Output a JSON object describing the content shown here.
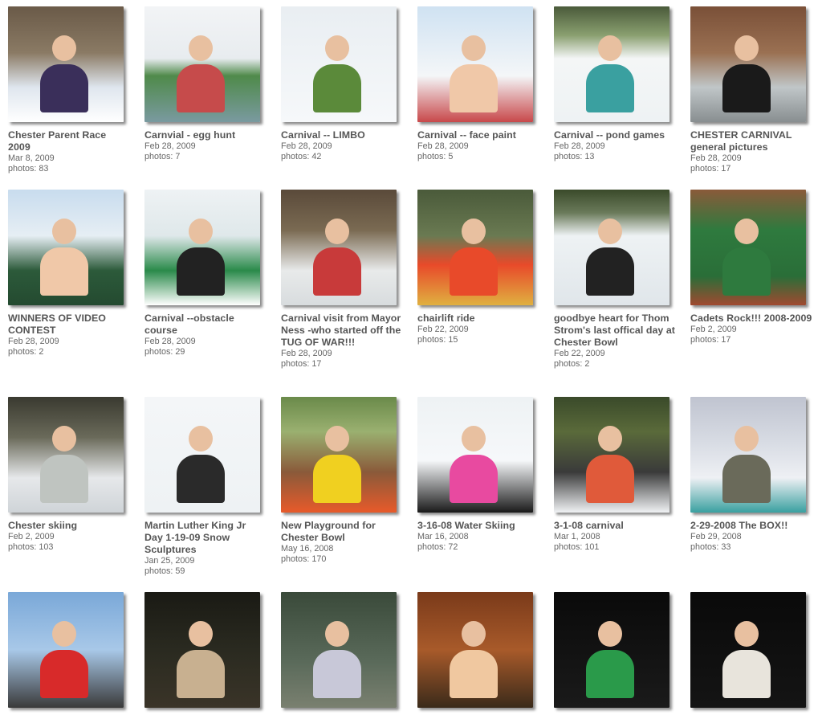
{
  "albums": [
    {
      "title": "Chester Parent Race 2009",
      "date": "Mar 8, 2009",
      "photos": "photos: 83",
      "bg": "linear-gradient(180deg,#6a5a48 0%,#8a7a64 40%,#dfe6ee 70%,#ffffff 100%)",
      "fig": "#3a2f5a"
    },
    {
      "title": "Carnvial - egg hunt",
      "date": "Feb 28, 2009",
      "photos": "photos: 7",
      "bg": "linear-gradient(180deg,#f2f4f6 0%,#e8ecef 45%,#4f8a4a 60%,#7a9aa0 100%)",
      "fig": "#c64b4b"
    },
    {
      "title": "Carnival -- LIMBO",
      "date": "Feb 28, 2009",
      "photos": "photos: 42",
      "bg": "linear-gradient(180deg,#e9eef2 0%,#f6f8fa 100%)",
      "fig": "#5b8a3a"
    },
    {
      "title": "Carnival -- face paint",
      "date": "Feb 28, 2009",
      "photos": "photos: 5",
      "bg": "linear-gradient(180deg,#cfe2f2 0%,#f4f6f8 60%,#c8484a 100%)",
      "fig": "#f0c8a8"
    },
    {
      "title": "Carnival -- pond games",
      "date": "Feb 28, 2009",
      "photos": "photos: 13",
      "bg": "linear-gradient(180deg,#4a5a3a 0%,#8aa070 25%,#f4f6f6 45%,#eef2f4 100%)",
      "fig": "#3aa0a0"
    },
    {
      "title": "CHESTER CARNIVAL general pictures",
      "date": "Feb 28, 2009",
      "photos": "photos: 17",
      "bg": "linear-gradient(180deg,#7a5038 0%,#9a7052 40%,#c0c6c8 70%,#888e90 100%)",
      "fig": "#1a1a1a"
    },
    {
      "title": "WINNERS OF VIDEO CONTEST",
      "date": "Feb 28, 2009",
      "photos": "photos: 2",
      "bg": "linear-gradient(180deg,#c8dcee 0%,#e6eef4 40%,#2c5a3a 70%,#244a30 100%)",
      "fig": "#f0c8a8"
    },
    {
      "title": "Carnival --obstacle course",
      "date": "Feb 28, 2009",
      "photos": "photos: 29",
      "bg": "linear-gradient(180deg,#eef2f4 0%,#dfe8ea 40%,#2a8a4a 70%,#ffffff 100%)",
      "fig": "#222222"
    },
    {
      "title": "Carnival visit from Mayor Ness -who started off the TUG OF WAR!!!",
      "date": "Feb 28, 2009",
      "photos": "photos: 17",
      "bg": "linear-gradient(180deg,#5a4a3a 0%,#7a6a52 35%,#e8eaea 70%,#d8dcde 100%)",
      "fig": "#c83a3a"
    },
    {
      "title": "chairlift ride",
      "date": "Feb 22, 2009",
      "photos": "photos: 15",
      "bg": "linear-gradient(180deg,#4a5a3a 0%,#6a7a52 40%,#e84a2a 65%,#e0b040 100%)",
      "fig": "#e84a2a"
    },
    {
      "title": "goodbye heart for Thom Strom's last offical day at Chester Bowl",
      "date": "Feb 22, 2009",
      "photos": "photos: 2",
      "bg": "linear-gradient(180deg,#3a4a2a 0%,#6a7a5a 20%,#eef2f4 40%,#e0e6ea 100%)",
      "fig": "#222222"
    },
    {
      "title": "Cadets Rock!!! 2008-2009",
      "date": "Feb 2, 2009",
      "photos": "photos: 17",
      "bg": "linear-gradient(180deg,#8a5a3a 0%,#2e7a3e 35%,#2a6e38 75%,#a04a30 100%)",
      "fig": "#2e7a3e"
    },
    {
      "title": "Chester skiing",
      "date": "Feb 2, 2009",
      "photos": "photos: 103",
      "bg": "linear-gradient(180deg,#3a3a30 0%,#6a6a5a 35%,#e6e8ea 70%,#cfd4d8 100%)",
      "fig": "#bfc4c0"
    },
    {
      "title": "Martin Luther King Jr Day 1-19-09 Snow Sculptures",
      "date": "Jan 25, 2009",
      "photos": "photos: 59",
      "bg": "linear-gradient(180deg,#f4f6f8 0%,#eef2f4 100%)",
      "fig": "#2a2a2a"
    },
    {
      "title": "New Playground for Chester Bowl",
      "date": "May 16, 2008",
      "photos": "photos: 170",
      "bg": "linear-gradient(180deg,#6a8a4a 0%,#9ab070 30%,#8a5a3a 65%,#e85a2a 100%)",
      "fig": "#f0d020"
    },
    {
      "title": "3-16-08 Water Skiing",
      "date": "Mar 16, 2008",
      "photos": "photos: 72",
      "bg": "linear-gradient(180deg,#eef2f4 0%,#f6f8fa 55%,#1a1a1a 100%)",
      "fig": "#e84aa0"
    },
    {
      "title": "3-1-08 carnival",
      "date": "Mar 1, 2008",
      "photos": "photos: 101",
      "bg": "linear-gradient(180deg,#3a4a2a 0%,#5a6a3a 30%,#3a3a3a 65%,#f0f2f4 100%)",
      "fig": "#e05a3a"
    },
    {
      "title": "2-29-2008 The BOX!!",
      "date": "Feb 29, 2008",
      "photos": "photos: 33",
      "bg": "linear-gradient(180deg,#c0c4d0 0%,#d8dce4 40%,#eef0f4 70%,#3aa0a0 100%)",
      "fig": "#6a6a5a"
    },
    {
      "title": "",
      "date": "",
      "photos": "",
      "bg": "linear-gradient(180deg,#7aa8d8 0%,#a8c8e8 50%,#3a3a3a 100%)",
      "fig": "#d82a2a"
    },
    {
      "title": "",
      "date": "",
      "photos": "",
      "bg": "linear-gradient(180deg,#1a1a14 0%,#2a2a20 50%,#3a3428 100%)",
      "fig": "#c8b090"
    },
    {
      "title": "",
      "date": "",
      "photos": "",
      "bg": "linear-gradient(180deg,#3a4a3a 0%,#5a6a5a 60%,#7a8070 100%)",
      "fig": "#c8c8d8"
    },
    {
      "title": "",
      "date": "",
      "photos": "",
      "bg": "linear-gradient(180deg,#7a3a1a 0%,#a85a2a 50%,#3a2a1a 100%)",
      "fig": "#f0c8a0"
    },
    {
      "title": "",
      "date": "",
      "photos": "",
      "bg": "linear-gradient(180deg,#0a0a0a 0%,#1a1a1a 100%)",
      "fig": "#2a9a4a"
    },
    {
      "title": "",
      "date": "",
      "photos": "",
      "bg": "linear-gradient(180deg,#0a0a0a 0%,#141414 100%)",
      "fig": "#e8e4dc"
    }
  ]
}
